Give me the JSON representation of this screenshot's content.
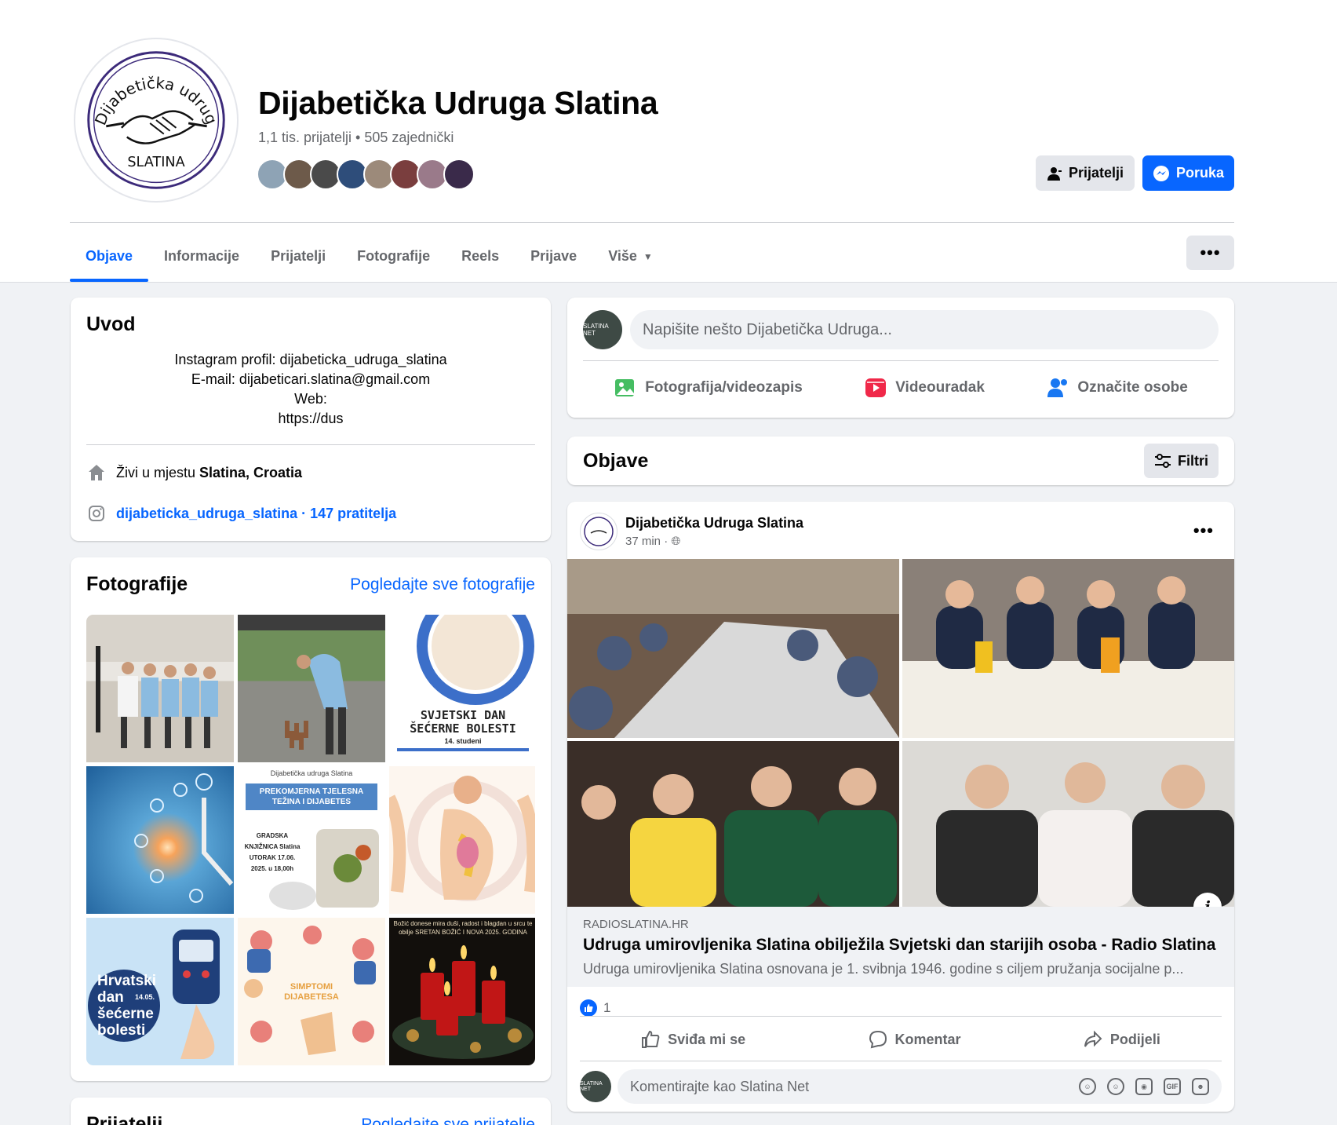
{
  "profile": {
    "name": "Dijabetička Udruga Slatina",
    "friends_summary": "1,1 tis. prijatelji • 505 zajednički",
    "logo_text_top": "Dijabetička udruga",
    "logo_text_bottom": "SLATINA",
    "friend_face_colors": [
      "#8ea3b5",
      "#6d5a4a",
      "#4a4a4a",
      "#2e4d7a",
      "#9c8a7a",
      "#7a3e3e",
      "#9a7a8a",
      "#3a2a4a"
    ]
  },
  "actions": {
    "friends_label": "Prijatelji",
    "message_label": "Poruka",
    "more_label": "•••"
  },
  "tabs": [
    {
      "label": "Objave",
      "active": true
    },
    {
      "label": "Informacije"
    },
    {
      "label": "Prijatelji"
    },
    {
      "label": "Fotografije"
    },
    {
      "label": "Reels"
    },
    {
      "label": "Prijave"
    },
    {
      "label": "Više"
    }
  ],
  "intro": {
    "title": "Uvod",
    "bio_lines": [
      "Instagram profil: dijabeticka_udruga_slatina",
      "E-mail: dijabeticari.slatina@gmail.com",
      "Web:",
      "https://dus"
    ],
    "lives_prefix": "Živi u mjestu ",
    "lives_place": "Slatina, Croatia",
    "instagram": "dijabeticka_udruga_slatina · 147 pratitelja"
  },
  "photos": {
    "title": "Fotografije",
    "see_all": "Pogledajte sve fotografije",
    "captions": {
      "p3": "SVJETSKI DAN\nŠEĆERNE BOLESTI",
      "p3_sub": "14. studeni",
      "p5_title": "PREKOMJERNA TJELESNA TEŽINA I DIJABETES",
      "p5_head": "Dijabetička udruga Slatina",
      "p5_place": "GRADSKA KNJIŽNICA Slatina UTORAK 17.06. 2025. u 18,00h",
      "p7": "Hrvatski dan šećerne bolesti",
      "p7_date": "14.05.",
      "p8": "SIMPTOMI DIJABETESA",
      "p9": "Božić donese mira duši, radost i blagdan u srcu te obilje SRETAN BOŽIĆ I NOVA 2025. GODINA"
    }
  },
  "friends_card": {
    "title": "Prijatelji",
    "see_all": "Pogledajte sve prijatelje"
  },
  "composer": {
    "placeholder": "Napišite nešto Dijabetička Udruga...",
    "avatar_text": "SLATINA NET",
    "photo_video": "Fotografija/videozapis",
    "reel": "Videouradak",
    "tag": "Označite osobe"
  },
  "posts_header": {
    "title": "Objave",
    "filters": "Filtri"
  },
  "post": {
    "author": "Dijabetička Udruga Slatina",
    "time": "37 min · ",
    "domain": "RADIOSLATINA.HR",
    "title": "Udruga umirovljenika Slatina obilježila Svjetski dan starijih osoba - Radio Slatina",
    "description": "Udruga umirovljenika Slatina osnovana je 1. svibnja 1946. godine s ciljem pružanja socijalne p...",
    "reaction_count": "1",
    "like": "Sviđa mi se",
    "comment": "Komentar",
    "share": "Podijeli",
    "comment_placeholder": "Komentirajte kao Slatina Net",
    "gif_label": "GIF"
  },
  "colors": {
    "accent": "#0866ff",
    "secondary_text": "#65676b",
    "background": "#f0f2f5"
  }
}
